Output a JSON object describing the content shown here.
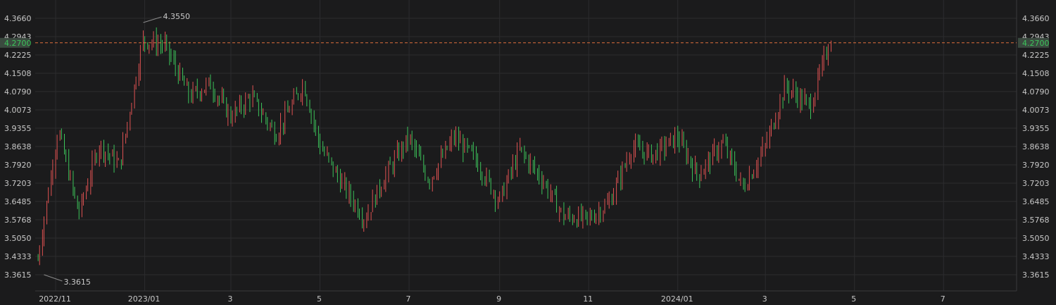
{
  "chart_data": {
    "type": "bar",
    "style": "ohlc",
    "y_ticks": [
      "3.3615",
      "3.4333",
      "3.5050",
      "3.5768",
      "3.6485",
      "3.7203",
      "3.7920",
      "3.8638",
      "3.9355",
      "4.0073",
      "4.0790",
      "4.1508",
      "4.2225",
      "4.2943",
      "4.3660"
    ],
    "ylim": [
      3.3615,
      4.366
    ],
    "x_ticks": [
      {
        "label": "2022/11",
        "date": "2022-11-01"
      },
      {
        "label": "2023/01",
        "date": "2023-01-01"
      },
      {
        "label": "3",
        "date": "2023-03-01"
      },
      {
        "label": "5",
        "date": "2023-05-01"
      },
      {
        "label": "7",
        "date": "2023-07-01"
      },
      {
        "label": "9",
        "date": "2023-09-01"
      },
      {
        "label": "11",
        "date": "2023-11-01"
      },
      {
        "label": "2024/01",
        "date": "2024-01-01"
      },
      {
        "label": "3",
        "date": "2024-03-01"
      },
      {
        "label": "5",
        "date": "2024-05-01"
      },
      {
        "label": "7",
        "date": "2024-07-01"
      }
    ],
    "xlim": [
      "2022-10-18",
      "2024-08-20"
    ],
    "current_price": "4.2700",
    "high_annotation": {
      "label": "4.3550",
      "date": "2022-12-31"
    },
    "low_annotation": {
      "label": "3.3615",
      "date": "2022-10-24"
    },
    "colors": {
      "up": "#e05252",
      "down": "#3cc45a",
      "grid": "#2c2c2e",
      "current_line": "#e0703c",
      "text": "#c8c8c8",
      "background": "#1b1b1c"
    },
    "grid": true,
    "series": [
      {
        "date": "2022-10-20",
        "close": 3.42
      },
      {
        "date": "2022-11-03",
        "close": 3.93
      },
      {
        "date": "2022-11-17",
        "close": 3.6
      },
      {
        "date": "2022-12-01",
        "close": 3.87
      },
      {
        "date": "2022-12-15",
        "close": 3.79
      },
      {
        "date": "2022-12-31",
        "close": 4.28
      },
      {
        "date": "2023-01-15",
        "close": 4.26
      },
      {
        "date": "2023-02-01",
        "close": 4.06
      },
      {
        "date": "2023-02-15",
        "close": 4.11
      },
      {
        "date": "2023-03-01",
        "close": 3.98
      },
      {
        "date": "2023-03-15",
        "close": 4.06
      },
      {
        "date": "2023-04-01",
        "close": 3.91
      },
      {
        "date": "2023-04-20",
        "close": 4.11
      },
      {
        "date": "2023-05-01",
        "close": 3.87
      },
      {
        "date": "2023-05-15",
        "close": 3.73
      },
      {
        "date": "2023-06-01",
        "close": 3.58
      },
      {
        "date": "2023-06-15",
        "close": 3.75
      },
      {
        "date": "2023-07-01",
        "close": 3.9
      },
      {
        "date": "2023-07-15",
        "close": 3.73
      },
      {
        "date": "2023-08-01",
        "close": 3.9
      },
      {
        "date": "2023-08-15",
        "close": 3.82
      },
      {
        "date": "2023-09-01",
        "close": 3.65
      },
      {
        "date": "2023-09-15",
        "close": 3.85
      },
      {
        "date": "2023-10-01",
        "close": 3.73
      },
      {
        "date": "2023-10-15",
        "close": 3.59
      },
      {
        "date": "2023-11-01",
        "close": 3.58
      },
      {
        "date": "2023-11-15",
        "close": 3.64
      },
      {
        "date": "2023-12-01",
        "close": 3.86
      },
      {
        "date": "2023-12-15",
        "close": 3.83
      },
      {
        "date": "2024-01-01",
        "close": 3.9
      },
      {
        "date": "2024-01-15",
        "close": 3.75
      },
      {
        "date": "2024-02-01",
        "close": 3.88
      },
      {
        "date": "2024-02-15",
        "close": 3.7
      },
      {
        "date": "2024-03-01",
        "close": 3.86
      },
      {
        "date": "2024-03-15",
        "close": 4.1
      },
      {
        "date": "2024-04-01",
        "close": 4.02
      },
      {
        "date": "2024-04-15",
        "close": 4.29
      }
    ]
  }
}
